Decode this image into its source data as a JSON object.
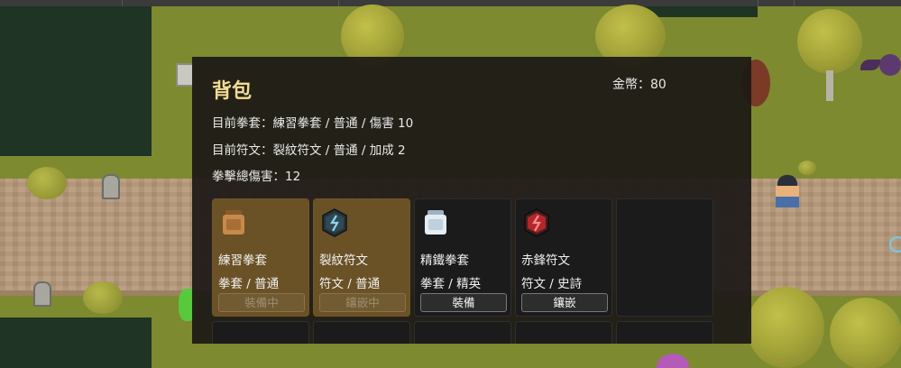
{
  "inventory": {
    "title": "背包",
    "gold": "金幣：80",
    "current_gloves": "目前拳套：練習拳套 / 普通 / 傷害 10",
    "current_rune": "目前符文：裂紋符文 / 普通 / 加成 2",
    "total_damage": "拳擊總傷害：12",
    "items": [
      {
        "name": "練習拳套",
        "type_rarity": "拳套 / 普通",
        "action": "裝備中",
        "icon": "glove-icon",
        "equipped": true,
        "color": "#b6804a"
      },
      {
        "name": "裂紋符文",
        "type_rarity": "符文 / 普通",
        "action": "鑲嵌中",
        "icon": "rune-icon",
        "equipped": true,
        "color": "#4a8fb0"
      },
      {
        "name": "精鐵拳套",
        "type_rarity": "拳套 / 精英",
        "action": "裝備",
        "icon": "glove-icon",
        "equipped": false,
        "color": "#d9e6f0"
      },
      {
        "name": "赤鋒符文",
        "type_rarity": "符文 / 史詩",
        "action": "鑲嵌",
        "icon": "rune-icon",
        "equipped": false,
        "color": "#c23b3b"
      }
    ]
  },
  "colors": {
    "title": "#f3dc93",
    "panel_bg": "rgba(28,25,22,0.93)",
    "equipped_slot": "#6a5126"
  }
}
